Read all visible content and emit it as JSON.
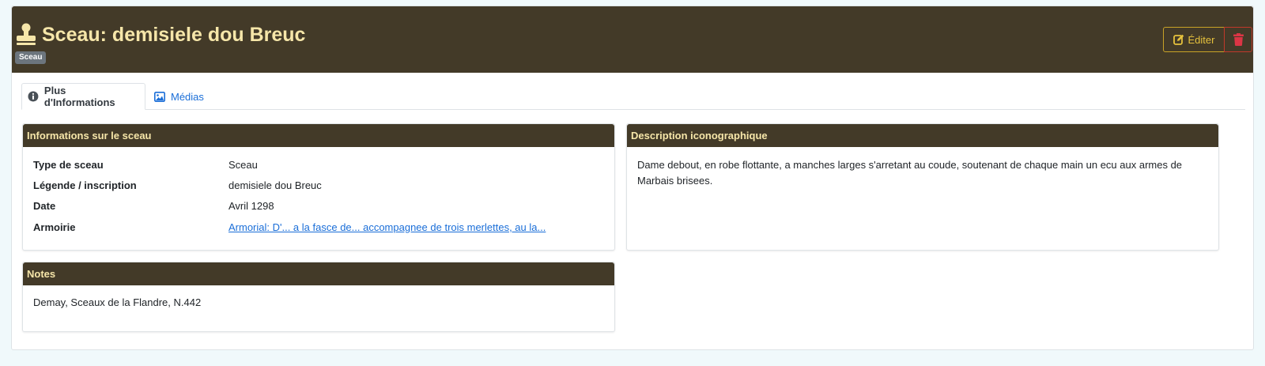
{
  "header": {
    "title": "Sceau: demisiele dou Breuc",
    "badge": "Sceau",
    "edit_label": "Éditer",
    "icon": "stamp-icon",
    "edit_icon": "edit-icon",
    "delete_icon": "trash-icon"
  },
  "tabs": [
    {
      "label": "Plus d'Informations",
      "icon": "info-circle-icon",
      "active": true
    },
    {
      "label": "Médias",
      "icon": "image-icon",
      "active": false
    }
  ],
  "seal_info": {
    "heading": "Informations sur le sceau",
    "rows": [
      {
        "label": "Type de sceau",
        "value": "Sceau"
      },
      {
        "label": "Légende / inscription",
        "value": "demisiele dou Breuc"
      },
      {
        "label": "Date",
        "value": "Avril 1298"
      },
      {
        "label": "Armoirie",
        "value": "Armorial: D'... a la fasce de... accompagnee de trois merlettes, au la..."
      }
    ]
  },
  "description": {
    "heading": "Description iconographique",
    "text": "Dame debout, en robe flottante, a manches larges s'arretant au coude, soutenant de chaque main un ecu aux armes de Marbais brisees."
  },
  "notes": {
    "heading": "Notes",
    "text": "Demay, Sceaux de la Flandre, N.442"
  },
  "colors": {
    "header_bg": "#433a28",
    "header_text": "#f6e6a9",
    "edit_accent": "#e6c23d",
    "delete_accent": "#dc3545",
    "link": "#1a6ed8"
  }
}
